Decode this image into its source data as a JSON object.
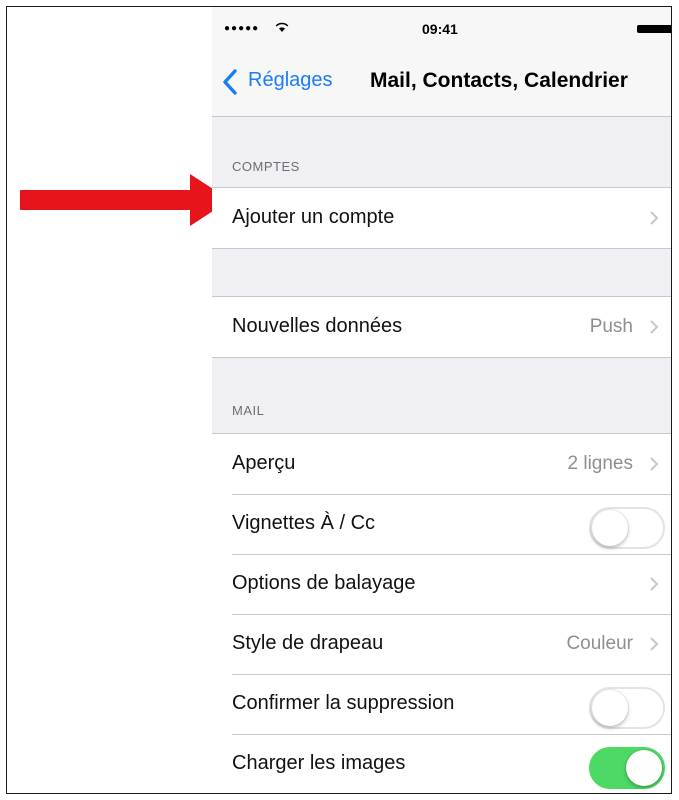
{
  "status_bar": {
    "signal": "●●●●●",
    "wifi_icon": "wifi-icon",
    "time": "09:41",
    "battery_icon": "battery-icon"
  },
  "nav": {
    "back_label": "Réglages",
    "title": "Mail, Contacts, Calendrier"
  },
  "sections": {
    "comptes_header": "COMPTES",
    "mail_header": "MAIL"
  },
  "rows": {
    "ajouter_compte": {
      "label": "Ajouter un compte"
    },
    "nouvelles_donnees": {
      "label": "Nouvelles données",
      "value": "Push"
    },
    "apercu": {
      "label": "Aperçu",
      "value": "2 lignes"
    },
    "vignettes": {
      "label": "Vignettes À / Cc",
      "toggle": false
    },
    "options_balayage": {
      "label": "Options de balayage"
    },
    "style_drapeau": {
      "label": "Style de drapeau",
      "value": "Couleur"
    },
    "confirmer_suppression": {
      "label": "Confirmer la suppression",
      "toggle": false
    },
    "charger_images": {
      "label": "Charger les images",
      "toggle": true
    }
  },
  "colors": {
    "accent": "#1c7cf4",
    "toggle_on": "#4cd964",
    "annotation_arrow": "#e8141c"
  }
}
